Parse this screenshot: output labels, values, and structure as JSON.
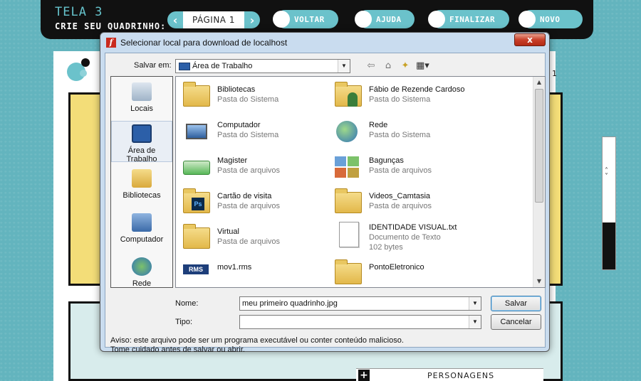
{
  "app": {
    "screen_title": "TELA 3",
    "screen_subtitle": "CRIE SEU QUADRINHO:",
    "page_label": "PÁGINA 1",
    "nav_buttons": [
      {
        "label": "VOLTAR"
      },
      {
        "label": "AJUDA"
      },
      {
        "label": "FINALIZAR"
      },
      {
        "label": "NOVO"
      }
    ],
    "page_number": "1",
    "personagens_label": "PERSONAGENS",
    "colors": {
      "teal": "#63b4be",
      "accent": "#6bc2cb",
      "header": "#111111"
    }
  },
  "dialog": {
    "title": "Selecionar local para download de localhost",
    "close_label": "x",
    "save_in_label": "Salvar em:",
    "save_in_value": "Área de Trabalho",
    "places": [
      {
        "label": "Locais"
      },
      {
        "label": "Área de Trabalho",
        "selected": true
      },
      {
        "label": "Bibliotecas"
      },
      {
        "label": "Computador"
      },
      {
        "label": "Rede"
      }
    ],
    "files": [
      {
        "name": "Bibliotecas",
        "type": "Pasta do Sistema",
        "icon": "libraries-icon"
      },
      {
        "name": "Fábio de Rezende Cardoso",
        "type": "Pasta do Sistema",
        "icon": "user-folder-icon"
      },
      {
        "name": "Computador",
        "type": "Pasta do Sistema",
        "icon": "computer-icon"
      },
      {
        "name": "Rede",
        "type": "Pasta do Sistema",
        "icon": "network-icon"
      },
      {
        "name": "Magister",
        "type": "Pasta de arquivos",
        "icon": "shortcut-icon"
      },
      {
        "name": "Bagunças",
        "type": "Pasta de arquivos",
        "icon": "pictures-folder-icon"
      },
      {
        "name": "Cartão de visita",
        "type": "Pasta de arquivos",
        "icon": "photoshop-folder-icon"
      },
      {
        "name": "Videos_Camtasia",
        "type": "Pasta de arquivos",
        "icon": "folder-icon"
      },
      {
        "name": "Virtual",
        "type": "Pasta de arquivos",
        "icon": "folder-icon"
      },
      {
        "name": "IDENTIDADE VISUAL.txt",
        "type": "Documento de Texto",
        "size": "102 bytes",
        "icon": "text-file-icon"
      },
      {
        "name": "mov1.rms",
        "type": "",
        "icon": "rms-file-icon"
      },
      {
        "name": "PontoEletronico",
        "type": "",
        "icon": "folder-icon"
      }
    ],
    "name_label": "Nome:",
    "name_value": "meu primeiro quadrinho.jpg",
    "type_label": "Tipo:",
    "type_value": "",
    "save_button": "Salvar",
    "cancel_button": "Cancelar",
    "warning": "Aviso: este arquivo pode ser um programa executável ou conter conteúdo malicioso. Tome cuidado antes de salvar ou abrir."
  }
}
